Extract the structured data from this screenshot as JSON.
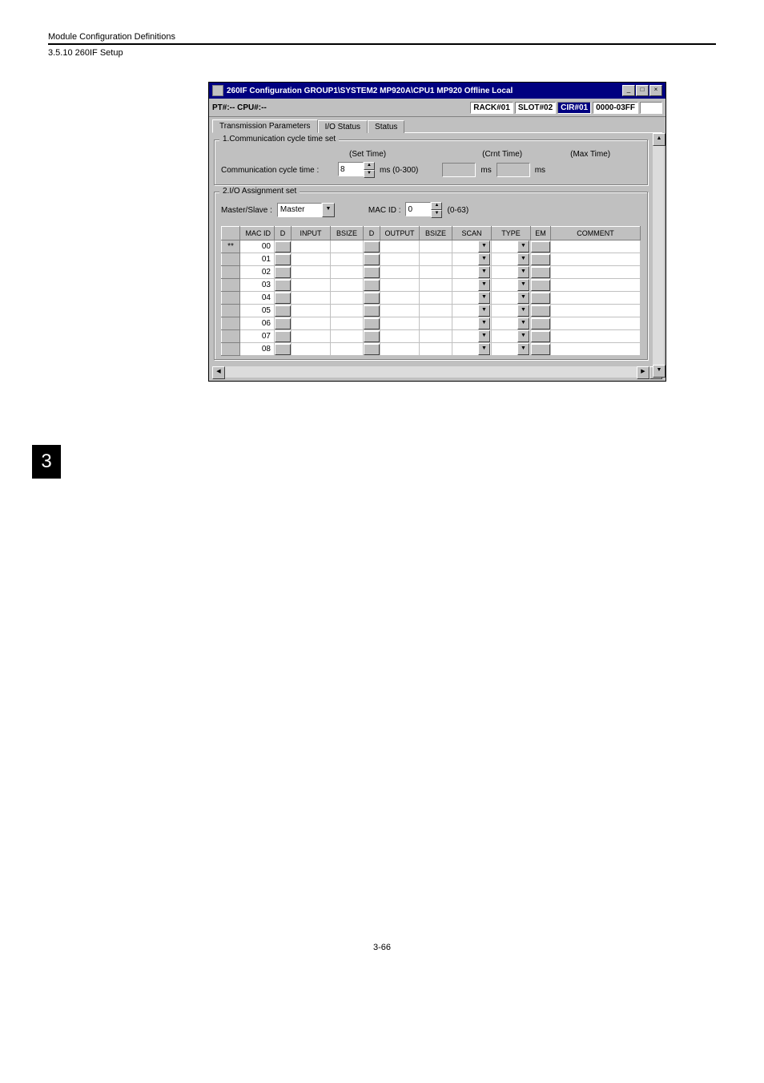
{
  "doc": {
    "header": "Module Configuration Definitions",
    "section": "3.5.10  260IF Setup",
    "side_tab": "3",
    "page_num": "3-66"
  },
  "window": {
    "title": "260IF Configuration    GROUP1\\SYSTEM2  MP920A\\CPU1  MP920      Offline  Local",
    "infobar_left": "PT#:-- CPU#:--",
    "status": {
      "rack": "RACK#01",
      "slot": "SLOT#02",
      "cir": "CIR#01",
      "range": "0000-03FF"
    },
    "tabs": {
      "t1": "Transmission Parameters",
      "t2": "I/O Status",
      "t3": "Status"
    },
    "group1": {
      "title": "1.Communication cycle time set",
      "label_comm": "Communication cycle time :",
      "set_time_label": "(Set Time)",
      "set_time_value": "8",
      "set_time_hint": "ms (0-300)",
      "crnt_time_label": "(Crnt Time)",
      "crnt_unit": "ms",
      "max_time_label": "(Max Time)",
      "max_unit": "ms"
    },
    "group2": {
      "title": "2.I/O Assignment set",
      "master_slave_label": "Master/Slave :",
      "master_slave_value": "Master",
      "macid_label": "MAC ID :",
      "macid_value": "0",
      "macid_hint": "(0-63)"
    },
    "table": {
      "headers": {
        "blank": "",
        "macid": "MAC ID",
        "d1": "D",
        "input": "INPUT",
        "bsize1": "BSIZE",
        "d2": "D",
        "output": "OUTPUT",
        "bsize2": "BSIZE",
        "scan": "SCAN",
        "type": "TYPE",
        "em": "EM",
        "comment": "COMMENT"
      },
      "rows": [
        {
          "sel": "**",
          "macid": "00"
        },
        {
          "sel": "",
          "macid": "01"
        },
        {
          "sel": "",
          "macid": "02"
        },
        {
          "sel": "",
          "macid": "03"
        },
        {
          "sel": "",
          "macid": "04"
        },
        {
          "sel": "",
          "macid": "05"
        },
        {
          "sel": "",
          "macid": "06"
        },
        {
          "sel": "",
          "macid": "07"
        },
        {
          "sel": "",
          "macid": "08"
        }
      ]
    }
  }
}
